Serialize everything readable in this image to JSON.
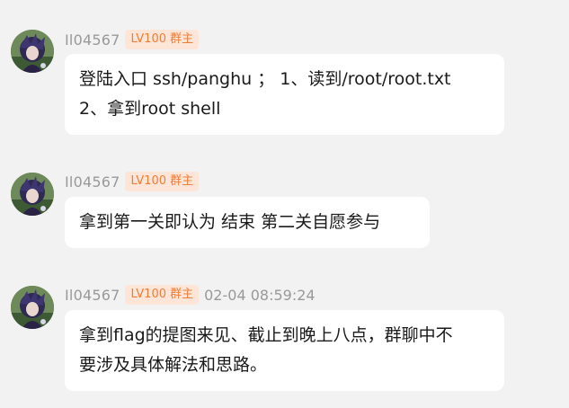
{
  "colors": {
    "background": "#f2f2f2",
    "bubble": "#ffffff",
    "badge_bg": "#fde6d8",
    "badge_text": "#f07c3a",
    "meta_text": "#999999"
  },
  "messages": [
    {
      "avatar_icon": "user-avatar-icon",
      "username": "Il04567",
      "badge": "LV100 群主",
      "timestamp": "",
      "lines": [
        "登陆入口 ssh/panghu ； 1、读到/root/root.txt",
        "2、拿到root shell"
      ]
    },
    {
      "avatar_icon": "user-avatar-icon",
      "username": "Il04567",
      "badge": "LV100 群主",
      "timestamp": "",
      "lines": [
        "拿到第一关即认为 结束  第二关自愿参与"
      ]
    },
    {
      "avatar_icon": "user-avatar-icon",
      "username": "Il04567",
      "badge": "LV100 群主",
      "timestamp": "02-04 08:59:24",
      "lines": [
        "拿到flag的提图来见、截止到晚上八点，群聊中不",
        "要涉及具体解法和思路。"
      ]
    }
  ]
}
